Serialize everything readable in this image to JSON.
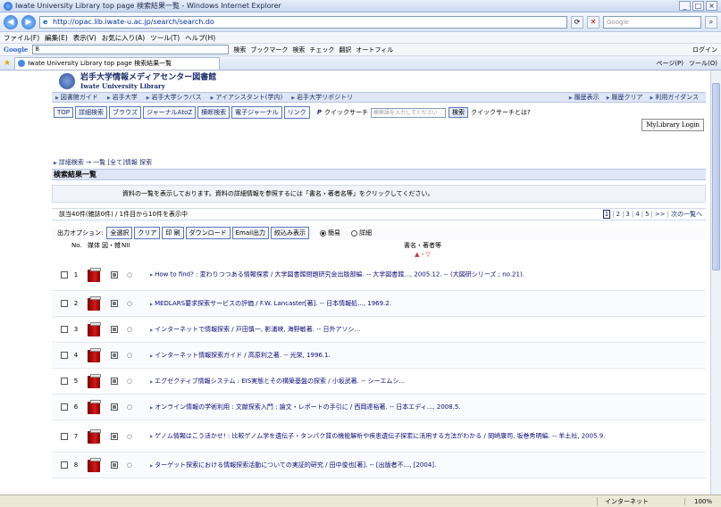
{
  "window": {
    "title": "Iwate University Library top page 検索結果一覧 - Windows Internet Explorer",
    "controls": [
      "_",
      "□",
      "×"
    ]
  },
  "address_bar": {
    "url": "http://opac.lib.iwate-u.ac.jp/search/search.do",
    "search_placeholder": "Google"
  },
  "menu": {
    "items": [
      "ファイル(F)",
      "編集(E)",
      "表示(V)",
      "お気に入り(A)",
      "ツール(T)",
      "ヘルプ(H)"
    ]
  },
  "google_toolbar": {
    "logo": "Google",
    "search_value": "8",
    "items": [
      "検索",
      "ブックマーク",
      "検索",
      "チェック",
      "翻訳",
      "オートフィル"
    ],
    "login": "ログイン"
  },
  "tabs": {
    "active": "Iwate University Library top page 検索結果一覧",
    "tools": [
      "ページ(P)",
      "ツール(O)"
    ]
  },
  "library": {
    "name": "岩手大学情報メディアセンター図書館",
    "name_en": "Iwate University Library",
    "topnav_left": [
      "図書館ガイド",
      "岩手大学",
      "岩手大学シラバス",
      "アイアシスタント(学内)",
      "岩手大学リポジトリ"
    ],
    "topnav_right": [
      "履歴表示",
      "履歴クリア",
      "利用ガイダンス"
    ],
    "nav_buttons": [
      "TOP",
      "詳細検索",
      "ブラウズ",
      "ジャーナルAtoZ",
      "横断検索",
      "電子ジャーナル",
      "リンク"
    ],
    "quick_label": "クイックサーチ",
    "quick_placeholder": "検索語を入力してください",
    "quick_button": "検索",
    "quick_help": "クイックサーチとは?",
    "mylibrary": "MyLibrary Login"
  },
  "breadcrumb": "詳細検索 → 一覧 [全て]情報 探索",
  "section_title": "検索結果一覧",
  "notice": "資料の一覧を表示しております。資料の詳細情報を参照するには「書名・著者名等」をクリックしてください。",
  "count": {
    "text": "該当40件(雑誌0件) / 1件目から10件を表示中",
    "pages": [
      "1",
      "2",
      "3",
      "4",
      "5"
    ],
    "more": ">>",
    "next": "次の一覧へ"
  },
  "options": {
    "label": "出力オプション:",
    "buttons": [
      "全選択",
      "クリア",
      "印 刷",
      "ダウンロード",
      "Email出力",
      "絞込み表示"
    ],
    "radio_simple": "簡易",
    "radio_detail": "詳細"
  },
  "table": {
    "headers": [
      "No.",
      "媒体",
      "図・雑",
      "NII",
      "書名・著者等"
    ],
    "sort": "▲・▽",
    "rows": [
      {
        "no": "1",
        "nii": "○",
        "title": "How to find? : 変わりつつある情報探索 / 大学図書館問題研究会出版部編. -- 大学図書館..., 2005.12. -- (大図研シリーズ ; no.21)."
      },
      {
        "no": "2",
        "nii": "○",
        "title": "MEDLARS要求探索サービスの評価 / F.W. Lancaster[著]. -- 日本情報処..., 1969.2."
      },
      {
        "no": "3",
        "nii": "○",
        "title": "インターネットで情報探索 / 戸田慎一, 影浦峡, 海野敏著. -- 日外アソシ..."
      },
      {
        "no": "4",
        "nii": "○",
        "title": "インターネット情報探索ガイド / 高原利之著. -- 光栄, 1996.1."
      },
      {
        "no": "5",
        "nii": "○",
        "title": "エグゼクティブ情報システム : EIS実態とその構築基盤の探索 / 小坂武著. -- シーエムシ..."
      },
      {
        "no": "6",
        "nii": "○",
        "title": "オンライン情報の学術利用 : 文献探索入門 : 論文・レポートの手引に / 西岡達裕著. -- 日本エディ..., 2008.5."
      },
      {
        "no": "7",
        "nii": "○",
        "title": "ゲノム情報はこう活かせ! : 比較ゲノム学を遺伝子・タンパク質の機能解析や疾患遺伝子探索に活用する方法がわかる / 岡崎康司, 坂巻秀明編. -- 羊土社, 2005.9."
      },
      {
        "no": "8",
        "nii": "○",
        "title": "ターゲット探索における情報探索活動についての実証的研究 / 田中俊也[著]. -- [出版者不..., [2004]."
      }
    ]
  },
  "status": {
    "zone": "インターネット",
    "zoom": "100%"
  }
}
